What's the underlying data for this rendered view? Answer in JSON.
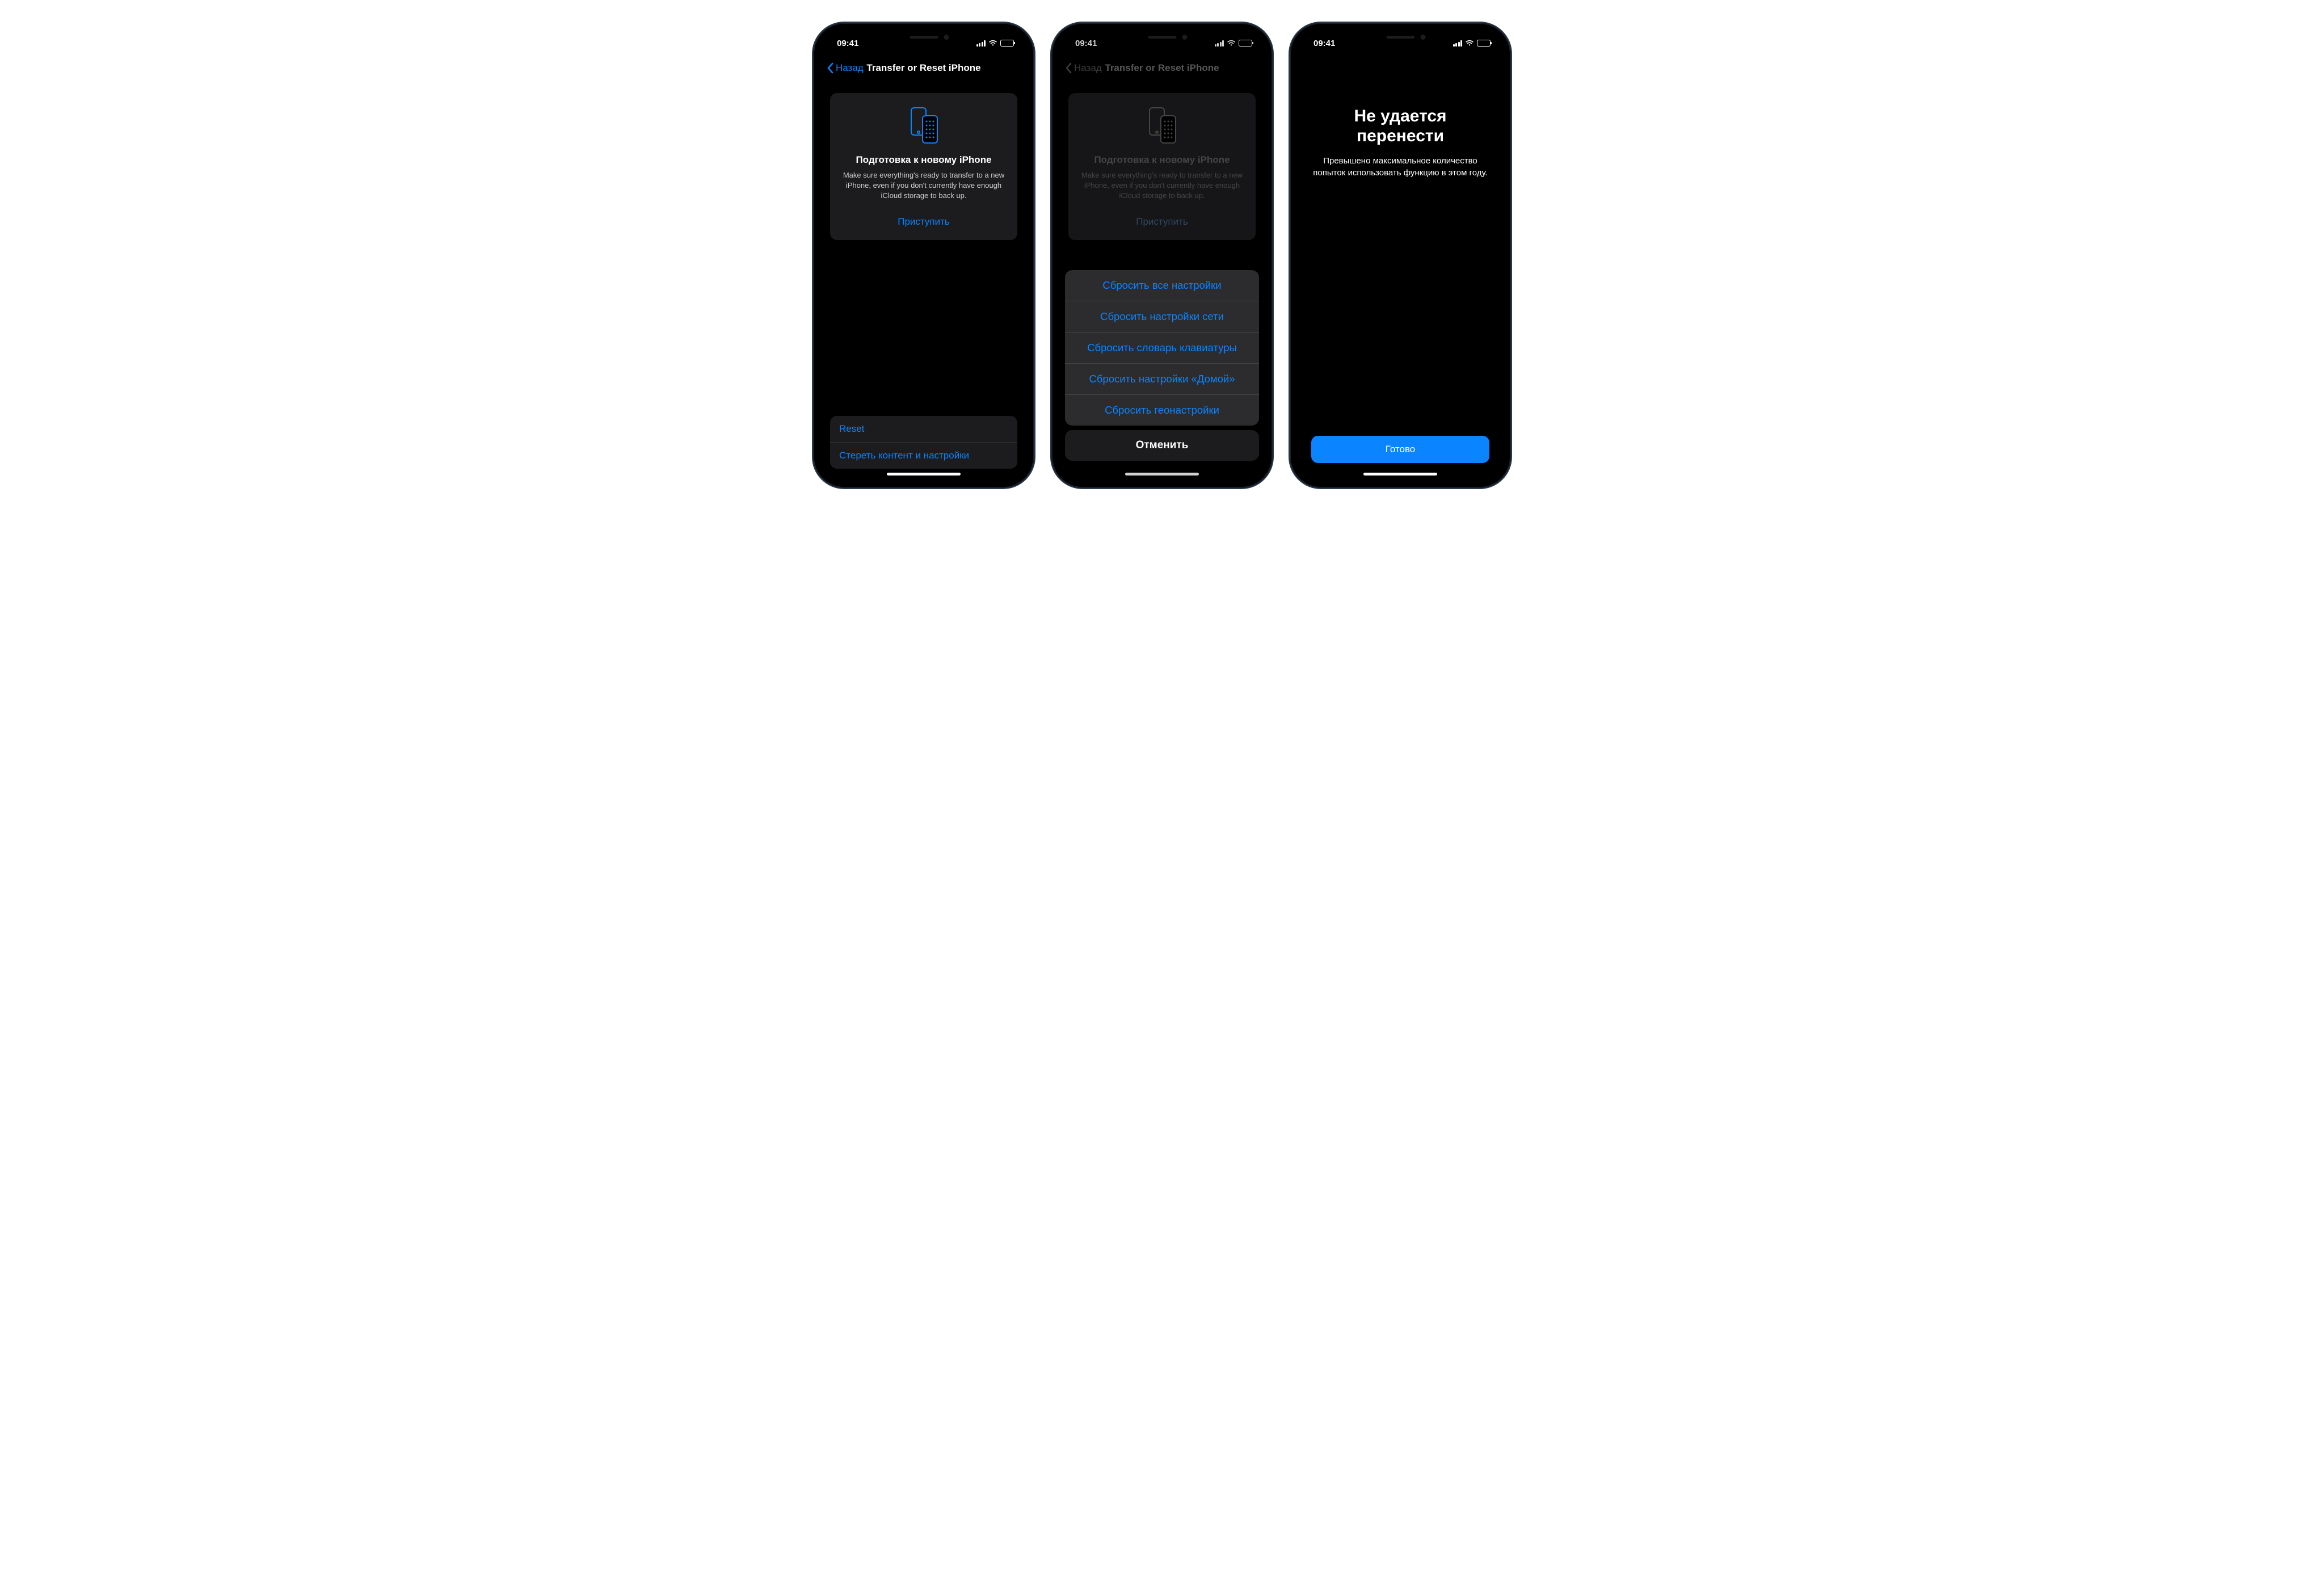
{
  "status": {
    "time": "09:41"
  },
  "screen1": {
    "back": "Назад",
    "title": "Transfer or Reset iPhone",
    "prep_title": "Подготовка к новому iPhone",
    "prep_desc": "Make sure everything's ready to transfer to a new iPhone, even if you don't currently have enough iCloud storage to back up.",
    "prep_link": "Приступить",
    "list": {
      "reset": "Reset",
      "erase": "Стереть контент и настройки"
    }
  },
  "screen2": {
    "back": "Назад",
    "title": "Transfer or Reset iPhone",
    "prep_title": "Подготовка к новому iPhone",
    "prep_desc": "Make sure everything's ready to transfer to a new iPhone, even if you don't currently have enough iCloud storage to back up.",
    "prep_link": "Приступить",
    "sheet": {
      "opt1": "Сбросить все настройки",
      "opt2": "Сбросить настройки сети",
      "opt3": "Сбросить словарь клавиатуры",
      "opt4": "Сбросить настройки «Домой»",
      "opt5": "Сбросить геонастройки",
      "cancel": "Отменить"
    }
  },
  "screen3": {
    "title": "Не удается перенести",
    "desc": "Превышено максимальное количество попыток использовать функцию в этом году.",
    "done": "Готово"
  }
}
